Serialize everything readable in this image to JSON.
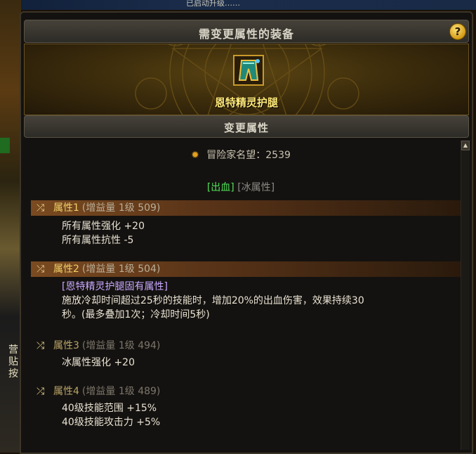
{
  "top_strip_text": "已启动升级……",
  "left_strip_text": "营\n贴\n按",
  "title": "需变更属性的装备",
  "help_label": "?",
  "item": {
    "name": "恩特精灵护腿",
    "icon": "leg-armor-icon"
  },
  "section_title": "变更属性",
  "fame": {
    "label": "冒险家名望",
    "separator": "：",
    "value": "2539"
  },
  "tags": {
    "bleed": "[出血]",
    "ice": "[冰属性]"
  },
  "attributes": [
    {
      "label": "属性1",
      "meta": "(增益量 1级 509)",
      "lines": [
        "所有属性强化 +20",
        "所有属性抗性 -5"
      ]
    },
    {
      "label": "属性2",
      "meta": "(增益量 1级 504)",
      "fixed": "[恩特精灵护腿固有属性]",
      "lines": [
        "施放冷却时间超过25秒的技能时，增加20%的出血伤害，效果持续30",
        "秒。(最多叠加1次；冷却时间5秒)"
      ]
    },
    {
      "label": "属性3",
      "meta": "(增益量 1级 494)",
      "lines": [
        "冰属性强化 +20"
      ]
    },
    {
      "label": "属性4",
      "meta": "(增益量 1级 489)",
      "lines": [
        "40级技能范围 +15%",
        "40级技能攻击力 +5%"
      ]
    }
  ],
  "colors": {
    "item_name": "#ffe97a",
    "bleed": "#52e05a",
    "active_header": "#7a4a20"
  }
}
